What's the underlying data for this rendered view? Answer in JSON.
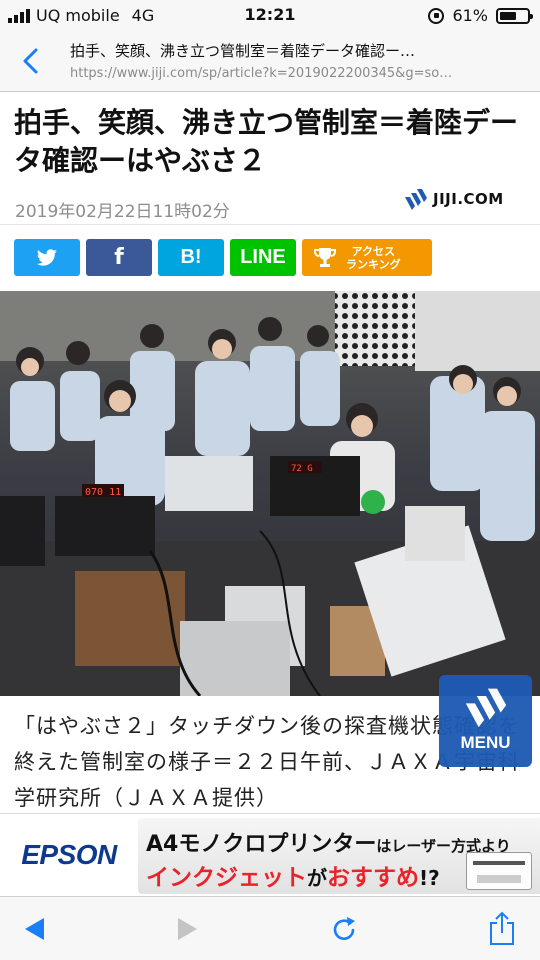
{
  "status_bar": {
    "carrier": "UQ mobile",
    "network": "4G",
    "time": "12:21",
    "battery_percent": "61%",
    "battery_level": 0.61
  },
  "browser": {
    "page_title": "拍手、笑顔、沸き立つ管制室＝着陸データ確認ー…",
    "url": "https://www.jiji.com/sp/article?k=2019022200345&g=so…"
  },
  "article": {
    "headline": "拍手、笑顔、沸き立つ管制室＝着陸データ確認ーはやぶさ２",
    "dateline": "2019年02月22日11時02分",
    "brand": "JIJI.COM",
    "caption": "「はやぶさ２」タッチダウン後の探査機状態確認を終えた管制室の様子＝２２日午前、ＪＡＸＡ宇宙科学研究所（ＪＡＸＡ提供）"
  },
  "share_buttons": {
    "facebook": "f",
    "hatena": "B!",
    "line": "LINE",
    "ranking_line1": "アクセス",
    "ranking_line2": "ランキング"
  },
  "photo_overlay": {
    "monitor_label_1": "070 11",
    "monitor_label_2": "72 G"
  },
  "menu_button": {
    "label": "MENU"
  },
  "ad": {
    "brand": "EPSON",
    "line1_main": "A4モノクロプリンター",
    "line1_small": "はレーザー方式より",
    "line2_red": "インクジェット",
    "line2_black1": "が",
    "line2_red2": "おすすめ",
    "line2_black2": "!?"
  },
  "colors": {
    "twitter": "#1da1f2",
    "facebook": "#3b5998",
    "hatena": "#00a4de",
    "line": "#00c300",
    "ranking": "#f39800",
    "ios_blue": "#1a7ef7",
    "menu": "#1e5bb4"
  },
  "icons": {
    "back": "chevron-left-icon",
    "twitter": "twitter-bird-icon",
    "trophy": "trophy-icon",
    "toolbar_back": "triangle-left-icon",
    "toolbar_forward": "triangle-right-icon",
    "reload": "reload-icon",
    "share": "share-icon"
  }
}
